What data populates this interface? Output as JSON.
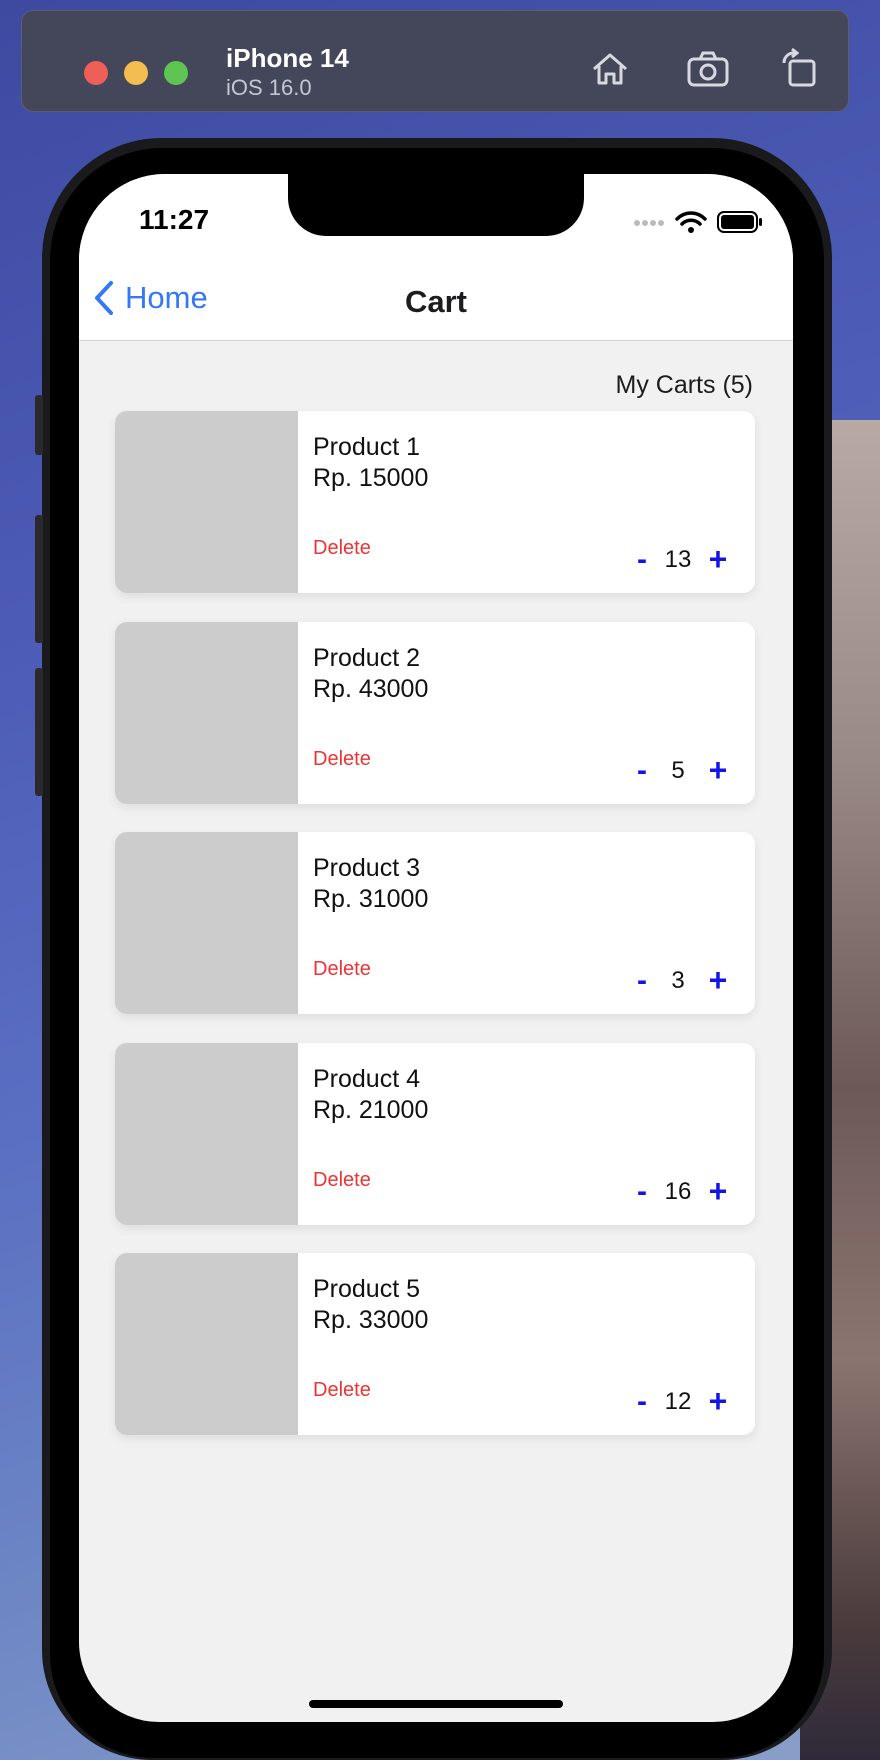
{
  "simulator": {
    "device_name": "iPhone 14",
    "os_version": "iOS 16.0",
    "icons": [
      "home-icon",
      "screenshot-icon",
      "rotate-icon"
    ]
  },
  "status_bar": {
    "time": "11:27",
    "icons": [
      "signal-icon",
      "wifi-icon",
      "battery-icon"
    ]
  },
  "nav": {
    "back_label": "Home",
    "title": "Cart"
  },
  "cart": {
    "count_label": "My Carts (5)",
    "items": [
      {
        "name": "Product 1",
        "price": "Rp. 15000",
        "delete_label": "Delete",
        "minus": "-",
        "quantity": "13",
        "plus": "+"
      },
      {
        "name": "Product 2",
        "price": "Rp. 43000",
        "delete_label": "Delete",
        "minus": "-",
        "quantity": "5",
        "plus": "+"
      },
      {
        "name": "Product 3",
        "price": "Rp. 31000",
        "delete_label": "Delete",
        "minus": "-",
        "quantity": "3",
        "plus": "+"
      },
      {
        "name": "Product 4",
        "price": "Rp. 21000",
        "delete_label": "Delete",
        "minus": "-",
        "quantity": "16",
        "plus": "+"
      },
      {
        "name": "Product 5",
        "price": "Rp. 33000",
        "delete_label": "Delete",
        "minus": "-",
        "quantity": "12",
        "plus": "+"
      }
    ]
  },
  "colors": {
    "accent_link": "#3478f6",
    "delete": "#e33333",
    "stepper": "#1414e6",
    "placeholder_image": "#cccccc"
  }
}
